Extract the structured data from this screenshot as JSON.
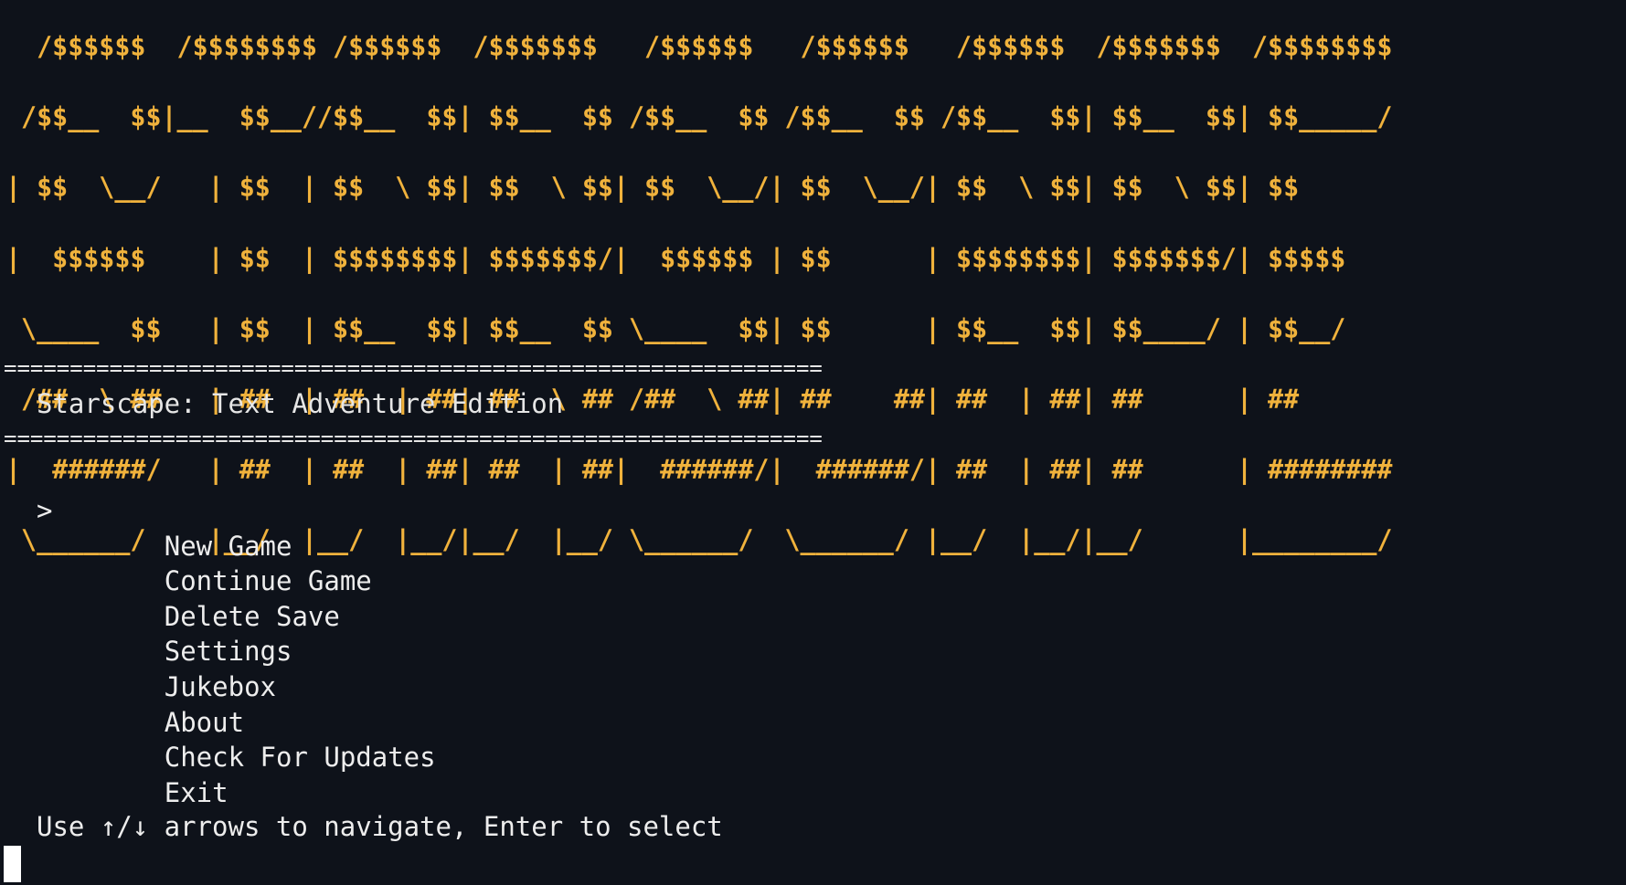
{
  "banner": {
    "lines": [
      "  /$$$$$$  /$$$$$$$$ /$$$$$$  /$$$$$$$   /$$$$$$   /$$$$$$   /$$$$$$  /$$$$$$$  /$$$$$$$$",
      " /$$__  $$|__  $$__//$$__  $$| $$__  $$ /$$__  $$ /$$__  $$ /$$__  $$| $$__  $$| $$_____/",
      "| $$  \\__/   | $$  | $$  \\ $$| $$  \\ $$| $$  \\__/| $$  \\__/| $$  \\ $$| $$  \\ $$| $$",
      "|  $$$$$$    | $$  | $$$$$$$$| $$$$$$$/|  $$$$$$ | $$      | $$$$$$$$| $$$$$$$/| $$$$$",
      " \\____  $$   | $$  | $$__  $$| $$__  $$ \\____  $$| $$      | $$__  $$| $$____/ | $$__/",
      " /##  \\ ##   | ##  | ##  | ##| ##  \\ ## /##  \\ ##| ##    ##| ##  | ##| ##      | ##",
      "|  ######/   | ##  | ##  | ##| ##  | ##|  ######/|  ######/| ##  | ##| ##      | ########",
      " \\______/    |__/  |__/  |__/|__/  |__/ \\______/  \\______/ |__/  |__/|__/      |________/"
    ]
  },
  "divider": "==============================================================",
  "title": "Starscape: Text Adventure Edition",
  "selection_marker": ">",
  "menu": {
    "items": [
      {
        "label": "New Game",
        "selected": true
      },
      {
        "label": "Continue Game",
        "selected": false
      },
      {
        "label": "Delete Save",
        "selected": false
      },
      {
        "label": "Settings",
        "selected": false
      },
      {
        "label": "Jukebox",
        "selected": false
      },
      {
        "label": "About",
        "selected": false
      },
      {
        "label": "Check For Updates",
        "selected": false
      },
      {
        "label": "Exit",
        "selected": false
      }
    ]
  },
  "hint": "Use ↑/↓ arrows to navigate, Enter to select",
  "colors": {
    "background": "#0e121a",
    "banner": "#f0b23c",
    "text": "#e6e6e6",
    "cursor": "#ffffff"
  }
}
